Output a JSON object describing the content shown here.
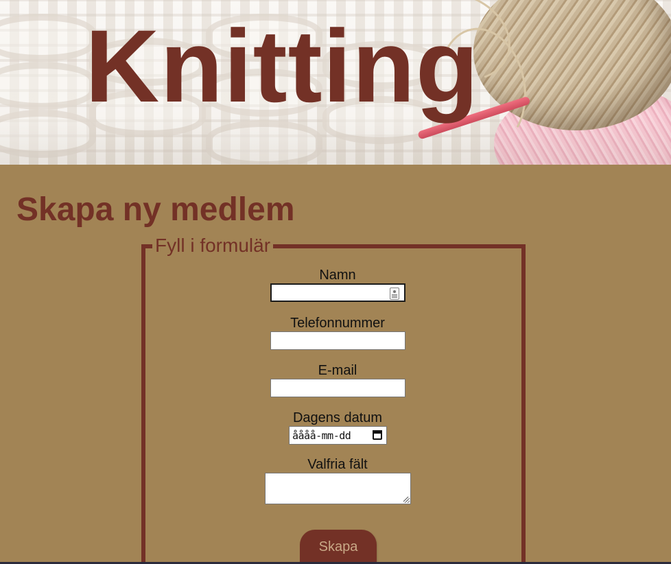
{
  "header": {
    "title": "Knitting"
  },
  "page": {
    "title": "Skapa ny medlem"
  },
  "form": {
    "legend": "Fyll i formulär",
    "fields": {
      "name": {
        "label": "Namn",
        "value": ""
      },
      "phone": {
        "label": "Telefonnummer",
        "value": ""
      },
      "email": {
        "label": "E-mail",
        "value": ""
      },
      "date": {
        "label": "Dagens datum",
        "placeholder": "åååå-mm-dd"
      },
      "optional": {
        "label": "Valfria fält",
        "value": ""
      }
    },
    "submit_label": "Skapa"
  },
  "colors": {
    "background": "#a28455",
    "accent": "#733126",
    "button_text": "#c9a987"
  },
  "icons": {
    "name_field": "contact-card-icon",
    "date_field": "calendar-icon"
  }
}
